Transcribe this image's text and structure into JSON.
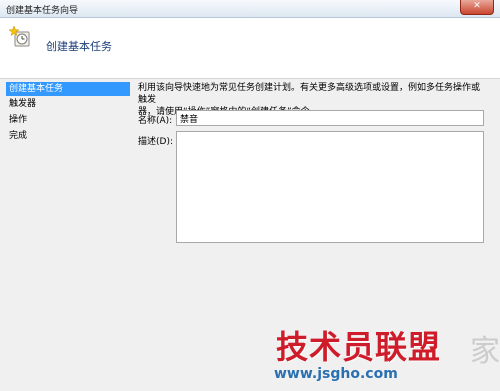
{
  "window": {
    "title": "创建基本任务向导",
    "close_glyph": "✕"
  },
  "header": {
    "heading": "创建基本任务"
  },
  "sidebar": {
    "items": [
      {
        "label": "创建基本任务",
        "active": true
      },
      {
        "label": "触发器",
        "active": false
      },
      {
        "label": "操作",
        "active": false
      },
      {
        "label": "完成",
        "active": false
      }
    ]
  },
  "main": {
    "description_line1": "利用该向导快速地为常见任务创建计划。有关更多高级选项或设置，例如多任务操作或触发",
    "description_line2": "器，请使用“操作”窗格中的“创建任务”命令。",
    "name_label": "名称(A):",
    "name_value": "禁音",
    "desc_label": "描述(D):",
    "desc_value": ""
  },
  "watermark": {
    "brand": "技术员联盟",
    "url": "www.jsgho.com",
    "side_char": "家"
  },
  "colors": {
    "accent": "#3399ff",
    "heading": "#1a3e78",
    "watermark_red": "#cf1c2a",
    "watermark_blue": "#2a6fb0"
  },
  "icons": {
    "header_icon": "task-sparkle-clock-icon"
  }
}
